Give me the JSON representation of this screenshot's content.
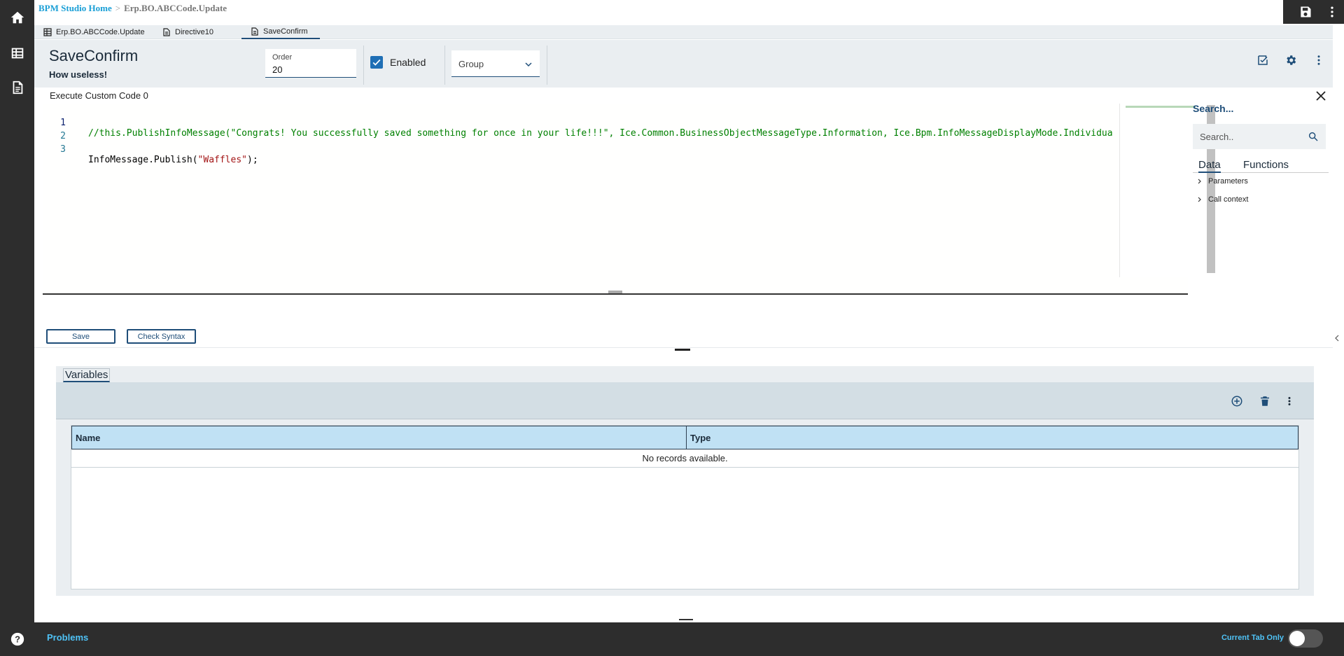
{
  "breadcrumb": {
    "home": "BPM Studio Home",
    "sep": ">",
    "current": "Erp.BO.ABCCode.Update"
  },
  "tabs": [
    {
      "label": "Erp.BO.ABCCode.Update",
      "icon": "grid-icon"
    },
    {
      "label": "Directive10",
      "icon": "doc-icon"
    },
    {
      "label": "SaveConfirm",
      "icon": "doc-icon",
      "active": true
    }
  ],
  "header": {
    "title": "SaveConfirm",
    "subtitle": "How useless!",
    "order_label": "Order",
    "order_value": "20",
    "enabled_label": "Enabled",
    "enabled_checked": true,
    "group_placeholder": "Group"
  },
  "editor": {
    "title": "Execute Custom Code 0",
    "lines": [
      {
        "num": "1",
        "text": "//this.PublishInfoMessage(\"Congrats! You successfully saved something for once in your life!!!\", Ice.Common.BusinessObjectMessageType.Information, Ice.Bpm.InfoMessageDisplayMode.Individua"
      },
      {
        "num": "2",
        "text": ""
      },
      {
        "num": "3",
        "prefix": "InfoMessage.Publish(",
        "string": "\"Waffles\"",
        "suffix": ");"
      }
    ]
  },
  "search_panel": {
    "heading": "Search...",
    "placeholder": "Search..",
    "tabs": [
      "Data",
      "Functions"
    ],
    "tree": [
      "Parameters",
      "Call context"
    ]
  },
  "buttons": {
    "save": "Save",
    "check_syntax": "Check Syntax"
  },
  "variables": {
    "tab_label": "Variables",
    "columns": [
      "Name",
      "Type"
    ],
    "empty_message": "No records available."
  },
  "bottom": {
    "problems": "Problems",
    "current_tab_only": "Current Tab Only"
  },
  "colors": {
    "accent": "#1f4e79",
    "link": "#1a9fd6",
    "rail": "#2d2d2d",
    "grid_header": "#c0e1f4"
  }
}
